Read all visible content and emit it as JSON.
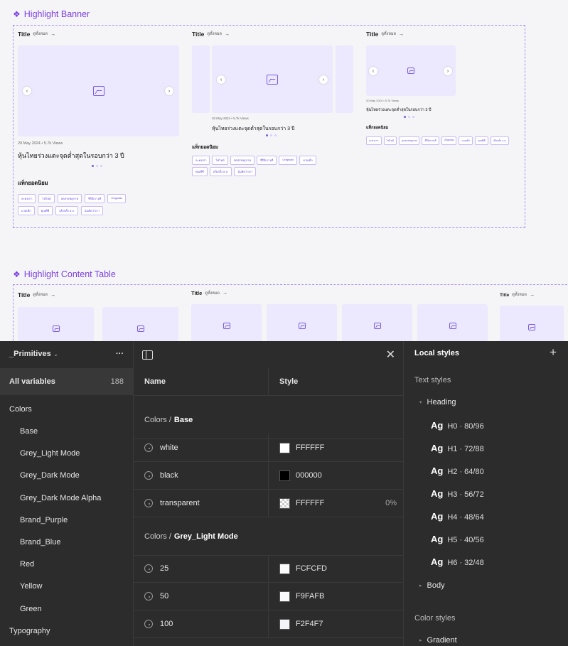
{
  "canvas": {
    "banner_title": "Highlight Banner",
    "content_table_title": "Highlight Content Table",
    "card_title": "Title",
    "see_all": "ดูทั้งหมด",
    "arrow": "→",
    "meta": "20 May 2024  •  5.7k Views",
    "headline": "หุ้นไทยร่วงแตะจุดต่ำสุดในรอบกว่า 3 ปี",
    "popular_tags_title": "แท็กยอดนิยม",
    "tags": [
      "ละครเก่า",
      "ไฟไหม้",
      "สดสรรพสุภาพ",
      "ซีรีส์เกาหลี",
      "Originals",
      "มวยเด็ก",
      "คุณพีซี",
      "เลือกตั้ง อ.บ.",
      "ฉันคิดว่าเรา"
    ],
    "prev": "‹",
    "next": "›"
  },
  "variables_panel": {
    "collection": "_Primitives",
    "dropdown": "⌄",
    "more": "···",
    "all_variables": "All variables",
    "count": "188",
    "groups": [
      {
        "label": "Colors",
        "type": "group"
      },
      {
        "label": "Base",
        "type": "sub"
      },
      {
        "label": "Grey_Light Mode",
        "type": "sub"
      },
      {
        "label": "Grey_Dark Mode",
        "type": "sub"
      },
      {
        "label": "Grey_Dark Mode Alpha",
        "type": "sub"
      },
      {
        "label": "Brand_Purple",
        "type": "sub"
      },
      {
        "label": "Brand_Blue",
        "type": "sub"
      },
      {
        "label": "Red",
        "type": "sub"
      },
      {
        "label": "Yellow",
        "type": "sub"
      },
      {
        "label": "Green",
        "type": "sub"
      },
      {
        "label": "Typography",
        "type": "group"
      }
    ]
  },
  "table": {
    "col_name": "Name",
    "col_style": "Style",
    "close": "✕",
    "group1_prefix": "Colors /",
    "group1_name": "Base",
    "group2_prefix": "Colors /",
    "group2_name": "Grey_Light Mode",
    "rows_base": [
      {
        "name": "white",
        "value": "FFFFFF",
        "color": "#FFFFFF",
        "pct": ""
      },
      {
        "name": "black",
        "value": "000000",
        "color": "#000000",
        "pct": ""
      },
      {
        "name": "transparent",
        "value": "FFFFFF",
        "color": "checker",
        "pct": "0%"
      }
    ],
    "rows_grey": [
      {
        "name": "25",
        "value": "FCFCFD",
        "color": "#FCFCFD"
      },
      {
        "name": "50",
        "value": "F9FAFB",
        "color": "#F9FAFB"
      },
      {
        "name": "100",
        "value": "F2F4F7",
        "color": "#F2F4F7"
      }
    ]
  },
  "local_styles": {
    "title": "Local styles",
    "add": "+",
    "text_styles": "Text styles",
    "heading": "Heading",
    "headings": [
      {
        "ag": "Ag",
        "label": "H0 · 80/96"
      },
      {
        "ag": "Ag",
        "label": "H1 · 72/88"
      },
      {
        "ag": "Ag",
        "label": "H2 · 64/80"
      },
      {
        "ag": "Ag",
        "label": "H3 · 56/72"
      },
      {
        "ag": "Ag",
        "label": "H4 · 48/64"
      },
      {
        "ag": "Ag",
        "label": "H5 · 40/56"
      },
      {
        "ag": "Ag",
        "label": "H6 · 32/48"
      }
    ],
    "body": "Body",
    "color_styles": "Color styles",
    "gradient": "Gradient",
    "caret_open": "▾",
    "caret_closed": "▸"
  }
}
